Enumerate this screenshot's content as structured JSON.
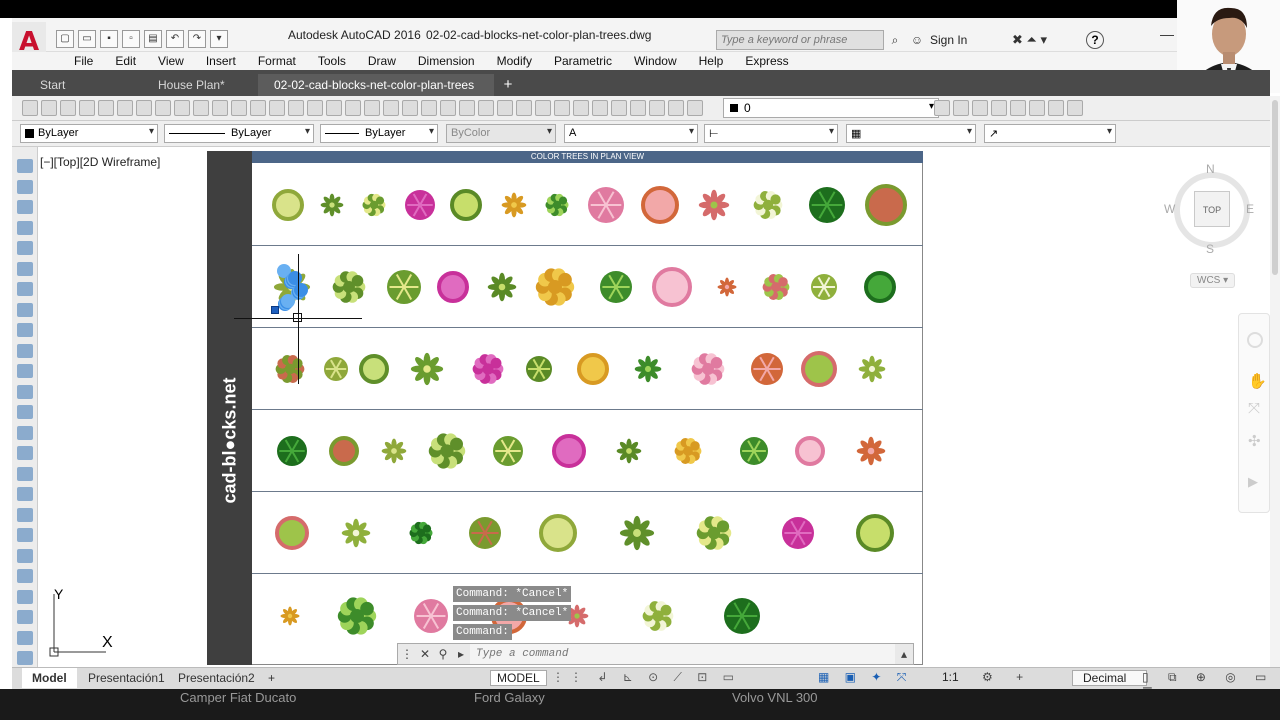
{
  "app": {
    "title": "Autodesk AutoCAD 2016",
    "document": "02-02-cad-blocks-net-color-plan-trees.dwg",
    "logo": "A"
  },
  "search": {
    "placeholder": "Type a keyword or phrase"
  },
  "account": {
    "signin": "Sign In"
  },
  "menu": [
    "File",
    "Edit",
    "View",
    "Insert",
    "Format",
    "Tools",
    "Draw",
    "Dimension",
    "Modify",
    "Parametric",
    "Window",
    "Help",
    "Express"
  ],
  "tabs": [
    {
      "label": "Start"
    },
    {
      "label": "House Plan*"
    },
    {
      "label": "02-02-cad-blocks-net-color-plan-trees"
    }
  ],
  "tab_plus": "+",
  "toolbar": {
    "layer_value": "0"
  },
  "properties": {
    "color": "ByLayer",
    "linetype": "ByLayer",
    "lineweight": "ByLayer",
    "plotstyle": "ByColor"
  },
  "viewport": {
    "label": "[−][Top][2D Wireframe]"
  },
  "drawing": {
    "header": "COLOR TREES IN PLAN VIEW",
    "side_text": "cad-bl●cks.net"
  },
  "viewcube": {
    "top": "TOP",
    "north": "N",
    "south": "S",
    "east": "E",
    "west": "W",
    "wcs": "WCS ▾"
  },
  "ucs": {
    "x": "X",
    "y": "Y"
  },
  "command": {
    "history": [
      "Command: *Cancel*",
      "Command: *Cancel*",
      "Command:"
    ],
    "placeholder": "Type a command"
  },
  "layout_tabs": [
    {
      "label": "Model"
    },
    {
      "label": "Presentación1"
    },
    {
      "label": "Presentación2"
    }
  ],
  "layout_plus": "+",
  "status": {
    "model": "MODEL",
    "scale": "1:1",
    "units": "Decimal"
  },
  "bottom": [
    "Camper Fiat Ducato",
    "Ford Galaxy",
    "Volvo VNL 300"
  ],
  "colors": {
    "accent": "#c8102e",
    "header": "#4c6688",
    "strip": "#3f3f3f",
    "tabbar": "#4a4a4a"
  },
  "icons": [
    "search-icon",
    "signin-icon",
    "exchange-icon",
    "help-icon",
    "viewcube-icon",
    "command-close-icon",
    "command-wrench-icon"
  ]
}
